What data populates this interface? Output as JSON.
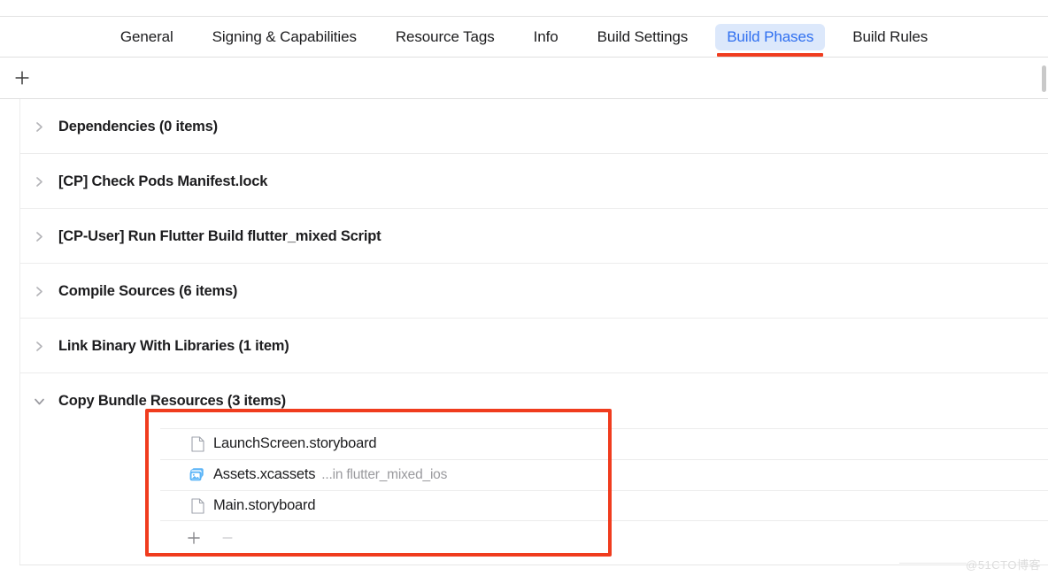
{
  "tabs": [
    {
      "label": "General",
      "active": false
    },
    {
      "label": "Signing & Capabilities",
      "active": false
    },
    {
      "label": "Resource Tags",
      "active": false
    },
    {
      "label": "Info",
      "active": false
    },
    {
      "label": "Build Settings",
      "active": false
    },
    {
      "label": "Build Phases",
      "active": true
    },
    {
      "label": "Build Rules",
      "active": false
    }
  ],
  "toolbar": {
    "add_icon": "plus-icon",
    "add_label": "+"
  },
  "phases": [
    {
      "title": "Dependencies (0 items)",
      "expanded": false,
      "chevron": "chevron-right-icon"
    },
    {
      "title": "[CP] Check Pods Manifest.lock",
      "expanded": false,
      "chevron": "chevron-right-icon"
    },
    {
      "title": "[CP-User] Run Flutter Build flutter_mixed Script",
      "expanded": false,
      "chevron": "chevron-right-icon"
    },
    {
      "title": "Compile Sources (6 items)",
      "expanded": false,
      "chevron": "chevron-right-icon"
    },
    {
      "title": "Link Binary With Libraries (1 item)",
      "expanded": false,
      "chevron": "chevron-right-icon"
    },
    {
      "title": "Copy Bundle Resources (3 items)",
      "expanded": true,
      "chevron": "chevron-down-icon"
    }
  ],
  "files": [
    {
      "name": "LaunchScreen.storyboard",
      "sub": "",
      "icon": "document-file-icon"
    },
    {
      "name": "Assets.xcassets",
      "sub": "...in flutter_mixed_ios",
      "icon": "asset-catalog-icon"
    },
    {
      "name": "Main.storyboard",
      "sub": "",
      "icon": "document-file-icon"
    }
  ],
  "file_actions": {
    "add_label": "+",
    "remove_label": "−",
    "add_icon": "plus-icon",
    "remove_icon": "minus-icon"
  },
  "annotation": {
    "color": "#f03c1e",
    "tab_underline_color": "#f03c1e"
  },
  "colors": {
    "accent_blue": "#2f6ff0",
    "tab_pill_bg": "#dce8fb",
    "annotation_red": "#f03c1e",
    "text_primary": "#1d1d1f",
    "text_secondary": "#9a9a9e",
    "separator": "#ececec"
  },
  "watermark": {
    "text": "@51CTO博客"
  }
}
